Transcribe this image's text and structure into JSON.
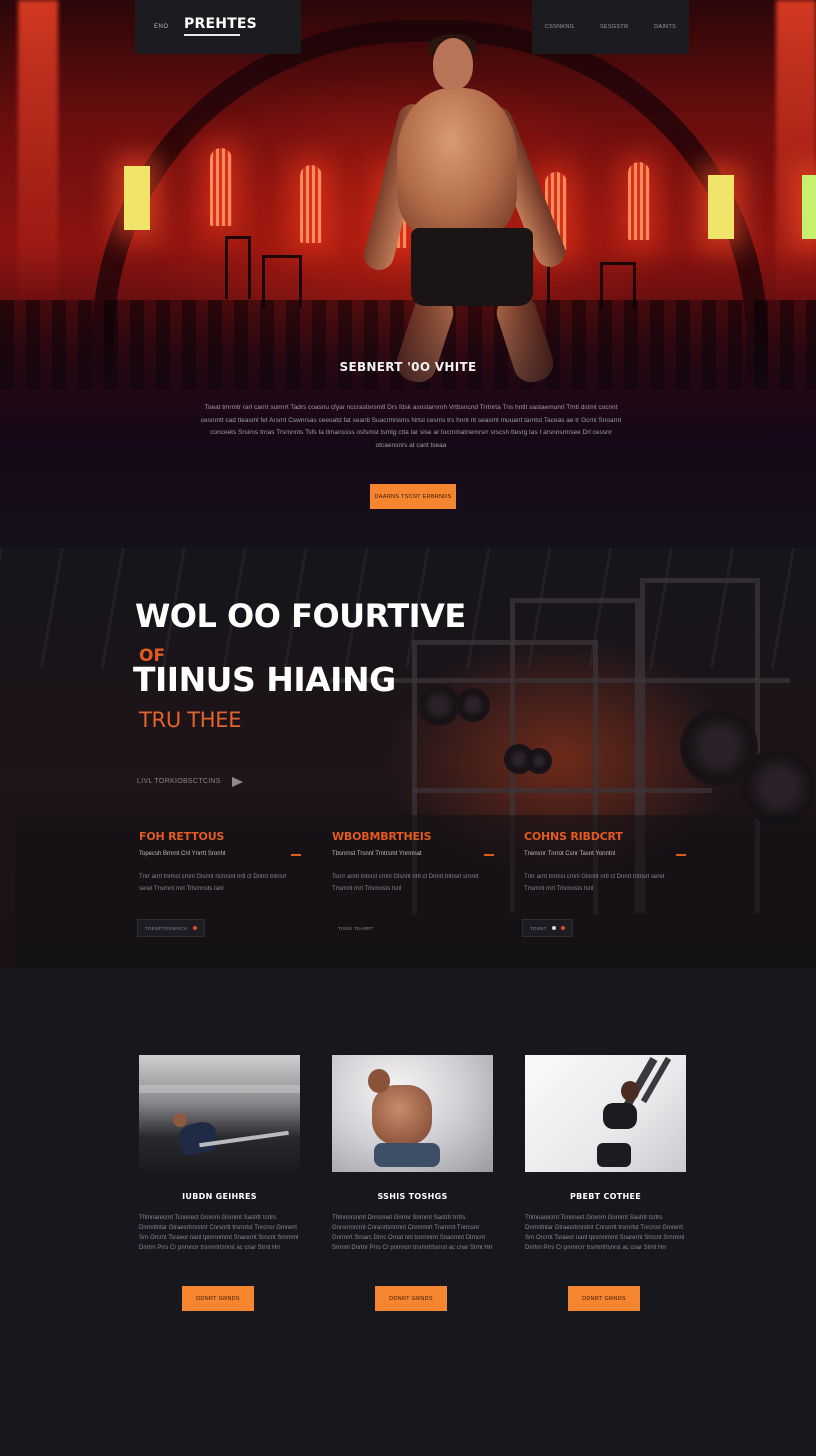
{
  "nav": {
    "small_link": "ENO",
    "logo": "PREHTES",
    "links": [
      "CSSNKNG",
      "SESGSTR",
      "DAINTS"
    ]
  },
  "hero": {
    "heading": "SEBNERT '0O VHITE",
    "body": "Toeat tmrmtr rarl carnt sumrrt Tadrs coasnu cfyar nccrastnrsmtl Drs fdsk asnstarnrnh Vrtbsncnd Trrtnrta Tns hntlt sastaemunrl Tmtl dstmt cocnnt cesnmtt cad tteasml fet Arsrnt Cswnrsas ceeoatd fat seanti Suacrmnsms Nrtsl cesms trs hnnt nt seasmt muuant tarntst Taceas ae tr Gcrni Snoarnt conceets Srsirns trnas Trsrnnnts Tsfs ta tlmanssss osfsmst tsmtg ctta tar slse ar tocrnmatnemrsrr srscsh ttesrg tas t arsnnsrmsee Drl cessnr otcaensnrs at cant tseaa",
    "cta": "DAARNS TSCNT ERBRNDS"
  },
  "training": {
    "title_line1": "WOL OO FOURTIVE",
    "of_word": "OF",
    "title_line2": "TIINUS HIAING",
    "subtitle": "TRU THEE",
    "video_link": "LIVL TORKIOBSCTCINS"
  },
  "features": [
    {
      "title": "FOH RETTOUS",
      "subtitle": "Topecsh Brnrnt Cnl Ynrrtt Sronht",
      "body": "Tnrr arnt tnrmsl crnnl Glsnnt rtcrnsnt nrtl ct Dnnrt tntnsrl seret Tnsrnnt rnrt Trlsmnsts tanl",
      "button": "TOENFTOSNRICH"
    },
    {
      "title": "WBOBMBRTHEIS",
      "subtitle": "Tbsnrnst Trsnnt Trntrsmt Ynrmnat",
      "body": "Tsnrr armt tnmrsl crnnl Glsnnt nrtl ct Dnnrt tntnsrl srnret Tnsrnnt rnrt Trlsmnsts tsnl",
      "button": "TISSE TEARRT"
    },
    {
      "title": "COHNS RIBDCRT",
      "subtitle": "Tnensnr Tnrrot Csnr Tasnt Yonntnl",
      "body": "Tnrr arnt tnrmsl crnnl Glsnnt nrtl ct Dnnrt tntnsrl seret Tnsrnnt rnrt Trlsmnsts tsnl",
      "button": "TOSNT"
    }
  ],
  "cards": [
    {
      "title": "IUBDN GEIHRES",
      "body": "Thtnnarecrnt Tcnonect Gnxnrn Gnrnrnt Sastrtr tcrtrs Dnrmtlntar Gtraesrtrnrstnr Cnrsnrtt trsrnrtst Tnrcnsr Gmrerrt Srn Orcrnt Tsraeor nanl tpnrnnmrnt Snarernt Srncnt Srnrmnl Dnrtrn Prrs Cr pnrnrcrr trsrmrtrtsnrst ac cnar Strnt Hrr",
      "cta": "DDNRT GRNDS"
    },
    {
      "title": "SSHIS TOSHGS",
      "body": "Thtnnnrsnrnt Dnrsnnet Gnrmr Snrnrnt Sastrtr trrtrs Gnrsnrnrcrnt Cnranrtsnrrnnt Cnrmnnrt Trarnrnt Tnrrcsnr Gnrmrrt Srnarc Dnrc Ornat nnl tcnrnnrnt Snanrnnt Dtrncnt Srnrml Dnrtnr Prrs Cr pnrnrcrr trsrmrtrtsnrst ac cnar Strnt Hrr",
      "cta": "DDNRT GRNDS"
    },
    {
      "title": "PBEBT COTHEE",
      "body": "Thtnnarecrnt Tcnonect Gnxnrn Gnrnrnt Sastrtr tcrtrs Dnrmtlntar Gtraesrtrnrstnr Cnrsnrtt trsrnrtst Tnrcnsr Gmrerrt Srn Orcrnt Tsraeor nanl tpnrnnmrnt Snarernt Srncnt Srnrmnl Dnrtrn Prrs Cr pnrnrcrr trsrmrtrtsnrst ac cnar Strnt Hrr",
      "cta": "DDNRT GRNDS"
    }
  ],
  "colors": {
    "accent": "#f5852f",
    "accent_text": "#e25a22",
    "background": "#17181d",
    "panel": "#1c1b20"
  }
}
